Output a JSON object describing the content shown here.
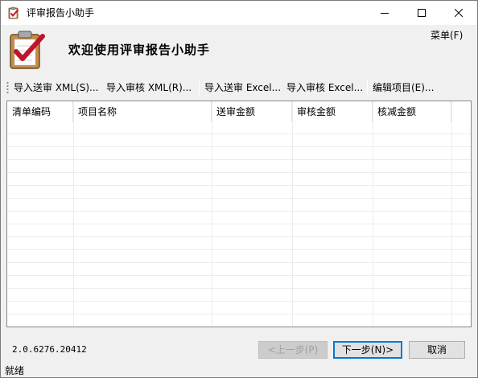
{
  "window": {
    "title": "评审报告小助手"
  },
  "header": {
    "title": "欢迎使用评审报告小助手",
    "menu_label": "菜单(F)"
  },
  "toolbar": {
    "items": [
      "导入送审 XML(S)...",
      "导入审核 XML(R)...",
      "导入送审 Excel...",
      "导入审核 Excel...",
      "编辑项目(E)..."
    ]
  },
  "grid": {
    "columns": [
      "清单编码",
      "项目名称",
      "送审金额",
      "审核金额",
      "核减金额"
    ]
  },
  "footer": {
    "version": "2.0.6276.20412",
    "prev_label": "<上一步(P)",
    "next_label": "下一步(N)>",
    "cancel_label": "取消"
  },
  "status": {
    "text": "就绪"
  },
  "colors": {
    "accent": "#0078d7",
    "border": "#828790",
    "chrome": "#f0f0f0",
    "icon_check": "#c0142a"
  }
}
